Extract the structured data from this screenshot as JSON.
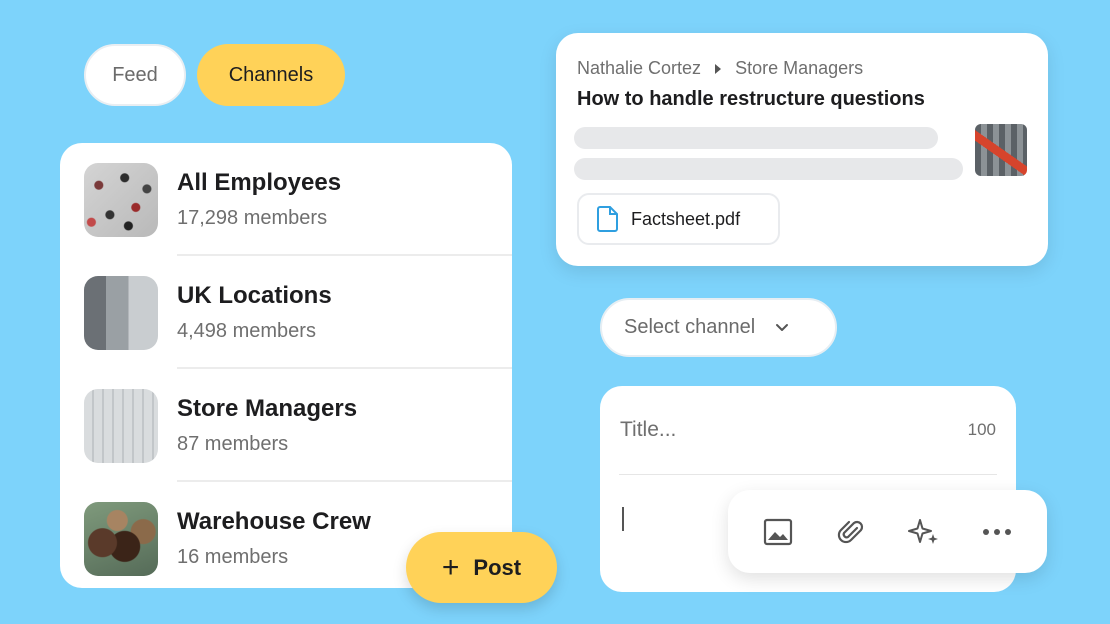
{
  "tabs": {
    "feed": "Feed",
    "channels": "Channels"
  },
  "channels": [
    {
      "name": "All Employees",
      "members": "17,298 members",
      "thumb": "crowd-photo"
    },
    {
      "name": "UK Locations",
      "members": "4,498 members",
      "thumb": "building-photo"
    },
    {
      "name": "Store Managers",
      "members": "87 members",
      "thumb": "tower-photo"
    },
    {
      "name": "Warehouse Crew",
      "members": "16 members",
      "thumb": "group-selfie-photo"
    }
  ],
  "post_button": {
    "label": "Post",
    "icon": "plus-icon"
  },
  "post": {
    "author": "Nathalie Cortez",
    "channel": "Store Managers",
    "title": "How to handle restructure questions",
    "attachment": "Factsheet.pdf"
  },
  "select_channel": {
    "label": "Select channel"
  },
  "composer": {
    "title_placeholder": "Title...",
    "char_count": "100"
  },
  "toolbar": {
    "icons": [
      "image-icon",
      "paperclip-icon",
      "sparkle-icon",
      "more-icon"
    ]
  },
  "colors": {
    "background": "#7dd3fb",
    "accent": "#ffd258",
    "file_icon": "#2f9fe0"
  }
}
